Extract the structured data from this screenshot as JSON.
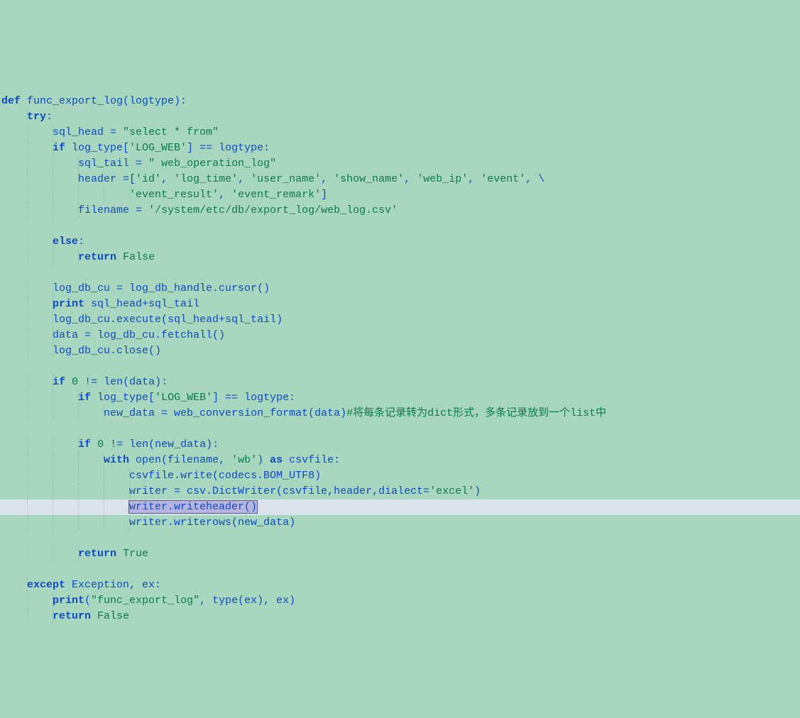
{
  "code": {
    "lines": [
      {
        "indent": 0,
        "cls": "",
        "tokens": [
          [
            "kw",
            "def"
          ],
          [
            "",
            " func_export_log(logtype):"
          ]
        ]
      },
      {
        "indent": 1,
        "cls": "",
        "tokens": [
          [
            "kw",
            "try"
          ],
          [
            "",
            ":"
          ]
        ]
      },
      {
        "indent": 2,
        "cls": "",
        "tokens": [
          [
            "",
            "sql_head = "
          ],
          [
            "str",
            "\"select * from\""
          ]
        ]
      },
      {
        "indent": 2,
        "cls": "",
        "tokens": [
          [
            "kw",
            "if"
          ],
          [
            "",
            " log_type["
          ],
          [
            "str",
            "'LOG_WEB'"
          ],
          [
            "",
            "] == logtype:"
          ]
        ]
      },
      {
        "indent": 3,
        "cls": "",
        "tokens": [
          [
            "",
            "sql_tail = "
          ],
          [
            "str",
            "\" web_operation_log\""
          ]
        ]
      },
      {
        "indent": 3,
        "cls": "",
        "tokens": [
          [
            "",
            "header =["
          ],
          [
            "str",
            "'id'"
          ],
          [
            "",
            ", "
          ],
          [
            "str",
            "'log_time'"
          ],
          [
            "",
            ", "
          ],
          [
            "str",
            "'user_name'"
          ],
          [
            "",
            ", "
          ],
          [
            "str",
            "'show_name'"
          ],
          [
            "",
            ", "
          ],
          [
            "str",
            "'web_ip'"
          ],
          [
            "",
            ", "
          ],
          [
            "str",
            "'event'"
          ],
          [
            "",
            ", \\"
          ]
        ]
      },
      {
        "indent": 5,
        "cls": "",
        "tokens": [
          [
            "str",
            "'event_result'"
          ],
          [
            "",
            ", "
          ],
          [
            "str",
            "'event_remark'"
          ],
          [
            "",
            "]"
          ]
        ]
      },
      {
        "indent": 3,
        "cls": "",
        "tokens": [
          [
            "",
            "filename = "
          ],
          [
            "str",
            "'/system/etc/db/export_log/web_log.csv'"
          ]
        ]
      },
      {
        "indent": 0,
        "cls": "",
        "tokens": []
      },
      {
        "indent": 2,
        "cls": "",
        "tokens": [
          [
            "kw",
            "else"
          ],
          [
            "",
            ":"
          ]
        ]
      },
      {
        "indent": 3,
        "cls": "",
        "tokens": [
          [
            "kw",
            "return"
          ],
          [
            "",
            " "
          ],
          [
            "lit",
            "False"
          ]
        ]
      },
      {
        "indent": 0,
        "cls": "",
        "tokens": []
      },
      {
        "indent": 2,
        "cls": "",
        "tokens": [
          [
            "",
            "log_db_cu = log_db_handle.cursor()"
          ]
        ]
      },
      {
        "indent": 2,
        "cls": "",
        "tokens": [
          [
            "kw",
            "print"
          ],
          [
            "",
            " sql_head+sql_tail"
          ]
        ]
      },
      {
        "indent": 2,
        "cls": "",
        "tokens": [
          [
            "",
            "log_db_cu.execute(sql_head+sql_tail)"
          ]
        ]
      },
      {
        "indent": 2,
        "cls": "",
        "tokens": [
          [
            "",
            "data = log_db_cu.fetchall()"
          ]
        ]
      },
      {
        "indent": 2,
        "cls": "",
        "tokens": [
          [
            "",
            "log_db_cu.close()"
          ]
        ]
      },
      {
        "indent": 0,
        "cls": "",
        "tokens": []
      },
      {
        "indent": 2,
        "cls": "",
        "tokens": [
          [
            "kw",
            "if"
          ],
          [
            "",
            " "
          ],
          [
            "lit",
            "0"
          ],
          [
            "",
            " != len(data):"
          ]
        ]
      },
      {
        "indent": 3,
        "cls": "",
        "tokens": [
          [
            "kw",
            "if"
          ],
          [
            "",
            " log_type["
          ],
          [
            "str",
            "'LOG_WEB'"
          ],
          [
            "",
            "] == logtype:"
          ]
        ]
      },
      {
        "indent": 4,
        "cls": "",
        "tokens": [
          [
            "",
            "new_data = web_conversion_format(data)"
          ],
          [
            "cm",
            "#将每条记录转为dict形式，多条记录放到一个list中"
          ]
        ]
      },
      {
        "indent": 0,
        "cls": "",
        "tokens": []
      },
      {
        "indent": 3,
        "cls": "",
        "tokens": [
          [
            "kw",
            "if"
          ],
          [
            "",
            " "
          ],
          [
            "lit",
            "0"
          ],
          [
            "",
            " != len(new_data):"
          ]
        ]
      },
      {
        "indent": 4,
        "cls": "",
        "tokens": [
          [
            "kw",
            "with"
          ],
          [
            "",
            " open(filename, "
          ],
          [
            "str",
            "'wb'"
          ],
          [
            "",
            ") "
          ],
          [
            "kw",
            "as"
          ],
          [
            "",
            " csvfile:"
          ]
        ]
      },
      {
        "indent": 5,
        "cls": "",
        "tokens": [
          [
            "",
            "csvfile.write(codecs.BOM_UTF8)"
          ]
        ]
      },
      {
        "indent": 5,
        "cls": "",
        "tokens": [
          [
            "",
            "writer = csv.DictWriter(csvfile,header,dialect="
          ],
          [
            "str",
            "'excel'"
          ],
          [
            "",
            ")"
          ]
        ]
      },
      {
        "indent": 5,
        "cls": "current",
        "tokens": [
          [
            "sel",
            "writer.writeheader()"
          ]
        ]
      },
      {
        "indent": 5,
        "cls": "",
        "tokens": [
          [
            "",
            "writer.writerows(new_data)"
          ]
        ]
      },
      {
        "indent": 0,
        "cls": "",
        "tokens": []
      },
      {
        "indent": 3,
        "cls": "",
        "tokens": [
          [
            "kw",
            "return"
          ],
          [
            "",
            " "
          ],
          [
            "lit",
            "True"
          ]
        ]
      },
      {
        "indent": 0,
        "cls": "",
        "tokens": []
      },
      {
        "indent": 1,
        "cls": "",
        "tokens": [
          [
            "kw",
            "except"
          ],
          [
            "",
            " Exception, ex:"
          ]
        ]
      },
      {
        "indent": 2,
        "cls": "",
        "tokens": [
          [
            "kw",
            "print"
          ],
          [
            "",
            "("
          ],
          [
            "str",
            "\"func_export_log\""
          ],
          [
            "",
            ", type(ex), ex)"
          ]
        ]
      },
      {
        "indent": 2,
        "cls": "",
        "tokens": [
          [
            "kw",
            "return"
          ],
          [
            "",
            " "
          ],
          [
            "lit",
            "False"
          ]
        ]
      }
    ],
    "indent_size": 4
  }
}
